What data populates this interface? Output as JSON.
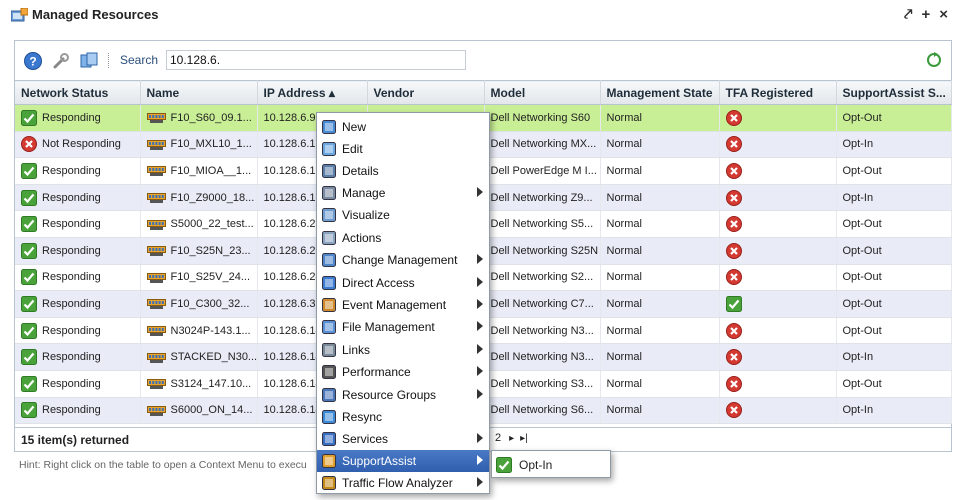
{
  "header": {
    "title": "Managed Resources",
    "title_icon": "managed-resources-icon",
    "tools": [
      "pin-icon",
      "add-icon",
      "close-icon"
    ],
    "tool_glyphs": [
      "⤤",
      "+",
      "×"
    ]
  },
  "toolbar": {
    "buttons": [
      "help-icon",
      "settings-wrench-icon",
      "resources-icon"
    ],
    "search_label": "Search",
    "search_value": "10.128.6.",
    "refresh_icon": "refresh-icon"
  },
  "table": {
    "columns": [
      "Network Status",
      "Name",
      "IP Address ▴",
      "Vendor",
      "Model",
      "Management State",
      "TFA Registered",
      "SupportAssist S..."
    ],
    "rows": [
      {
        "status": "Responding",
        "status_ok": true,
        "name": "F10_S60_09.1...",
        "ip": "10.128.6.9",
        "vendor": "",
        "model": "Dell Networking S60",
        "state": "Normal",
        "tfa": false,
        "support": "Opt-Out"
      },
      {
        "status": "Not Responding",
        "status_ok": false,
        "name": "F10_MXL10_1...",
        "ip": "10.128.6.12",
        "vendor": "",
        "model": "Dell Networking MX...",
        "state": "Normal",
        "tfa": false,
        "support": "Opt-In"
      },
      {
        "status": "Responding",
        "status_ok": true,
        "name": "F10_MIOA__1...",
        "ip": "10.128.6.17",
        "vendor": "",
        "model": "Dell PowerEdge M I...",
        "state": "Normal",
        "tfa": false,
        "support": "Opt-Out"
      },
      {
        "status": "Responding",
        "status_ok": true,
        "name": "F10_Z9000_18...",
        "ip": "10.128.6.18",
        "vendor": "",
        "model": "Dell Networking Z9...",
        "state": "Normal",
        "tfa": false,
        "support": "Opt-In"
      },
      {
        "status": "Responding",
        "status_ok": true,
        "name": "S5000_22_test...",
        "ip": "10.128.6.22",
        "vendor": "",
        "model": "Dell Networking S5...",
        "state": "Normal",
        "tfa": false,
        "support": "Opt-Out"
      },
      {
        "status": "Responding",
        "status_ok": true,
        "name": "F10_S25N_23...",
        "ip": "10.128.6.23",
        "vendor": "",
        "model": "Dell Networking S25N",
        "state": "Normal",
        "tfa": false,
        "support": "Opt-Out"
      },
      {
        "status": "Responding",
        "status_ok": true,
        "name": "F10_S25V_24...",
        "ip": "10.128.6.24",
        "vendor": "",
        "model": "Dell Networking S2...",
        "state": "Normal",
        "tfa": false,
        "support": "Opt-Out"
      },
      {
        "status": "Responding",
        "status_ok": true,
        "name": "F10_C300_32...",
        "ip": "10.128.6.32",
        "vendor": "",
        "model": "Dell Networking C7...",
        "state": "Normal",
        "tfa": true,
        "support": "Opt-Out"
      },
      {
        "status": "Responding",
        "status_ok": true,
        "name": "N3024P-143.1...",
        "ip": "10.128.6.14",
        "vendor": "",
        "model": "Dell Networking N3...",
        "state": "Normal",
        "tfa": false,
        "support": "Opt-Out"
      },
      {
        "status": "Responding",
        "status_ok": true,
        "name": "STACKED_N30...",
        "ip": "10.128.6.14",
        "vendor": "",
        "model": "Dell Networking N3...",
        "state": "Normal",
        "tfa": false,
        "support": "Opt-In"
      },
      {
        "status": "Responding",
        "status_ok": true,
        "name": "S3124_147.10...",
        "ip": "10.128.6.14",
        "vendor": "",
        "model": "Dell Networking S3...",
        "state": "Normal",
        "tfa": false,
        "support": "Opt-Out"
      },
      {
        "status": "Responding",
        "status_ok": true,
        "name": "S6000_ON_14...",
        "ip": "10.128.6.14",
        "vendor": "",
        "model": "Dell Networking S6...",
        "state": "Normal",
        "tfa": false,
        "support": "Opt-In"
      }
    ],
    "selected_row": 0
  },
  "footer": {
    "count_text": "15 item(s) returned",
    "page_number": "2",
    "next_glyph": "▸",
    "last_glyph": "▸|"
  },
  "hint": "Hint: Right click on the table to open a Context Menu to execu",
  "context_menu": {
    "items": [
      {
        "label": "New",
        "icon": "new-icon",
        "submenu": false
      },
      {
        "label": "Edit",
        "icon": "edit-icon",
        "submenu": false
      },
      {
        "label": "Details",
        "icon": "details-icon",
        "submenu": false
      },
      {
        "label": "Manage",
        "icon": "manage-icon",
        "submenu": true
      },
      {
        "label": "Visualize",
        "icon": "visualize-icon",
        "submenu": false
      },
      {
        "label": "Actions",
        "icon": "actions-icon",
        "submenu": false
      },
      {
        "label": "Change Management",
        "icon": "change-management-icon",
        "submenu": true
      },
      {
        "label": "Direct Access",
        "icon": "direct-access-icon",
        "submenu": true
      },
      {
        "label": "Event Management",
        "icon": "event-management-icon",
        "submenu": true
      },
      {
        "label": "File Management",
        "icon": "file-management-icon",
        "submenu": true
      },
      {
        "label": "Links",
        "icon": "links-icon",
        "submenu": true
      },
      {
        "label": "Performance",
        "icon": "performance-icon",
        "submenu": true
      },
      {
        "label": "Resource Groups",
        "icon": "resource-groups-icon",
        "submenu": true
      },
      {
        "label": "Resync",
        "icon": "resync-icon",
        "submenu": false
      },
      {
        "label": "Services",
        "icon": "services-icon",
        "submenu": true
      },
      {
        "label": "SupportAssist",
        "icon": "supportassist-icon",
        "submenu": true
      },
      {
        "label": "Traffic Flow Analyzer",
        "icon": "traffic-flow-analyzer-icon",
        "submenu": true
      }
    ],
    "active_index": 15
  },
  "submenu": {
    "item": "Opt-In",
    "icon": "opt-in-check-icon"
  },
  "colors": {
    "selected_row": "#c9ef96",
    "alt_row": "#e9ebf6",
    "menu_highlight": "#3b6bbb",
    "ok_green": "#4aa33a",
    "error_red": "#d23a32"
  }
}
